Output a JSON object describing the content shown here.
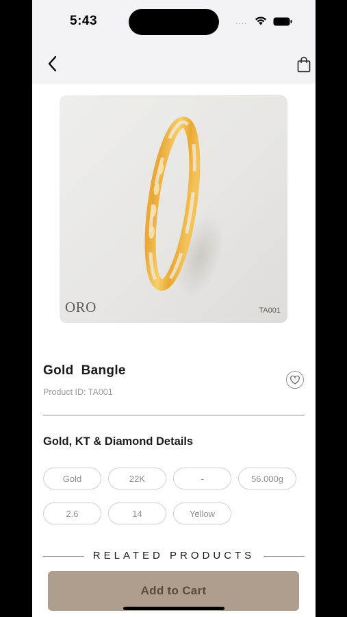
{
  "status_bar": {
    "time": "5:43"
  },
  "header": {
    "back_icon": "chevron-left-icon",
    "cart_icon": "shopping-bag-icon"
  },
  "product": {
    "image": {
      "brand": "ORO",
      "sku": "TA001"
    },
    "title": "Gold  Bangle",
    "product_id": "Product ID: TA001",
    "wishlist_icon": "heart-icon"
  },
  "details": {
    "title": "Gold, KT & Diamond Details",
    "chips": [
      "Gold",
      "22K",
      "-",
      "56.000g",
      "2.6",
      "14",
      "Yellow"
    ]
  },
  "related": {
    "label": "RELATED PRODUCTS"
  },
  "actions": {
    "add_to_cart": "Add to Cart"
  },
  "colors": {
    "cta_background": "#ad9e8d",
    "cta_text": "#5a4a3a",
    "header_background": "#f2f2f7"
  }
}
